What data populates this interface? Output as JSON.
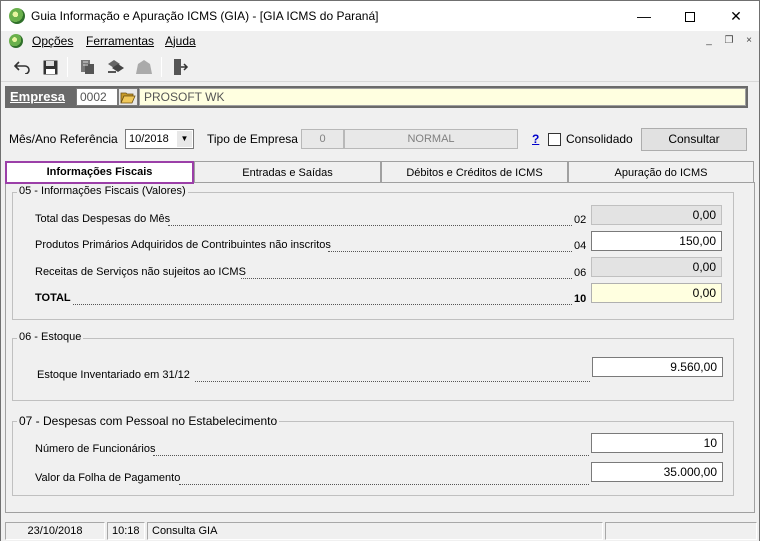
{
  "window": {
    "title": "Guia Informação e Apuração ICMS (GIA) - [GIA ICMS do Paraná]"
  },
  "menu": {
    "items": [
      "Opções",
      "Ferramentas",
      "Ajuda"
    ]
  },
  "empresa": {
    "label": "Empresa",
    "code": "0002",
    "name": "PROSOFT WK"
  },
  "filters": {
    "mes_ano_label": "Mês/Ano Referência",
    "mes_ano_value": "10/2018",
    "tipo_empresa_label": "Tipo de Empresa",
    "tipo_code": "0",
    "tipo_name": "NORMAL",
    "help": "?",
    "consolidado_label": "Consolidado",
    "consolidado_checked": false,
    "consultar": "Consultar"
  },
  "tabs": [
    {
      "label": "Informações Fiscais",
      "active": true
    },
    {
      "label": "Entradas e Saídas",
      "active": false
    },
    {
      "label": "Débitos e Créditos de ICMS",
      "active": false
    },
    {
      "label": "Apuração do ICMS",
      "active": false
    }
  ],
  "section05": {
    "title": "05 - Informações Fiscais (Valores)",
    "rows": [
      {
        "label": "Total das Despesas do Mês",
        "code": "02",
        "value": "0,00"
      },
      {
        "label": "Produtos Primários Adquiridos de Contribuintes não inscritos",
        "code": "04",
        "value": "150,00"
      },
      {
        "label": "Receitas de Serviços não sujeitos ao ICMS",
        "code": "06",
        "value": "0,00"
      },
      {
        "label": "TOTAL",
        "code": "10",
        "value": "0,00"
      }
    ]
  },
  "section06": {
    "title": "06 - Estoque",
    "label": "Estoque Inventariado em 31/12",
    "value": "9.560,00"
  },
  "section07": {
    "title": "07 - Despesas com Pessoal no Estabelecimento",
    "funcionarios_label": "Número de Funcionários",
    "funcionarios_value": "10",
    "folha_label": "Valor da Folha de Pagamento",
    "folha_value": "35.000,00"
  },
  "status": {
    "date": "23/10/2018",
    "time": "10:18",
    "message": "Consulta GIA"
  }
}
